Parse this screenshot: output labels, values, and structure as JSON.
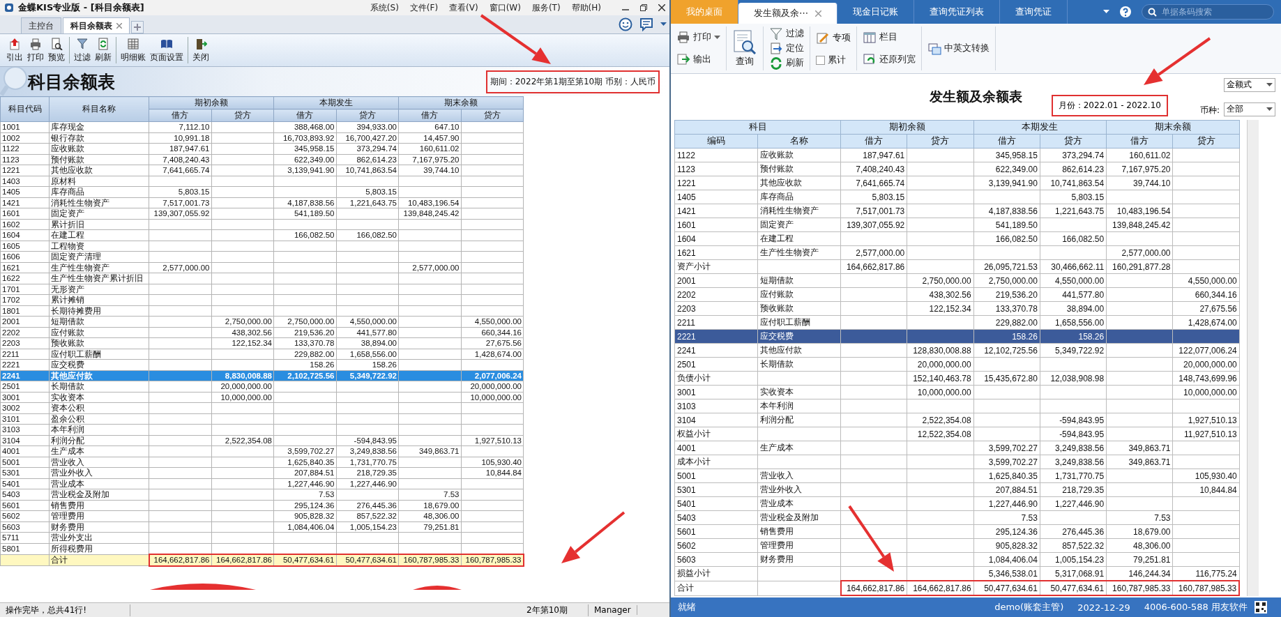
{
  "left_window": {
    "app_title": "金蝶KIS专业版 - [科目余额表]",
    "menu": [
      "系统(S)",
      "文件(F)",
      "查看(V)",
      "窗口(W)",
      "服务(T)",
      "帮助(H)"
    ],
    "tabs": [
      {
        "label": "主控台",
        "selected": false
      },
      {
        "label": "科目余额表",
        "selected": true
      }
    ],
    "toolbar": [
      "引出",
      "打印",
      "预览",
      "过滤",
      "刷新",
      "明细账",
      "页面设置",
      "关闭"
    ],
    "report_title": "科目余额表",
    "period_info": "期间：2022年第1期至第10期 币别：人民币",
    "header": {
      "code": "科目代码",
      "name": "科目名称",
      "groups": [
        "期初余额",
        "本期发生",
        "期末余额"
      ],
      "sides": [
        "借方",
        "贷方",
        "借方",
        "贷方",
        "借方",
        "贷方"
      ]
    },
    "rows": [
      {
        "code": "1001",
        "name": "库存现金",
        "selected": false,
        "values": {
          "opening_debit": "7,112.10",
          "period_debit": "388,468.00",
          "period_credit": "394,933.00",
          "closing_debit": "647.10"
        }
      },
      {
        "code": "1002",
        "name": "银行存款",
        "selected": false,
        "values": {
          "opening_debit": "10,991.18",
          "period_debit": "16,703,893.92",
          "period_credit": "16,700,427.20",
          "closing_debit": "14,457.90"
        }
      },
      {
        "code": "1122",
        "name": "应收账款",
        "selected": false,
        "values": {
          "opening_debit": "187,947.61",
          "period_debit": "345,958.15",
          "period_credit": "373,294.74",
          "closing_debit": "160,611.02"
        }
      },
      {
        "code": "1123",
        "name": "预付账款",
        "selected": false,
        "values": {
          "opening_debit": "7,408,240.43",
          "period_debit": "622,349.00",
          "period_credit": "862,614.23",
          "closing_debit": "7,167,975.20"
        }
      },
      {
        "code": "1221",
        "name": "其他应收款",
        "selected": false,
        "values": {
          "opening_debit": "7,641,665.74",
          "period_debit": "3,139,941.90",
          "period_credit": "10,741,863.54",
          "closing_debit": "39,744.10"
        }
      },
      {
        "code": "1403",
        "name": "原材料",
        "selected": false
      },
      {
        "code": "1405",
        "name": "库存商品",
        "selected": false,
        "values": {
          "opening_debit": "5,803.15",
          "period_credit": "5,803.15"
        }
      },
      {
        "code": "1421",
        "name": "消耗性生物资产",
        "selected": false,
        "values": {
          "opening_debit": "7,517,001.73",
          "period_debit": "4,187,838.56",
          "period_credit": "1,221,643.75",
          "closing_debit": "10,483,196.54"
        }
      },
      {
        "code": "1601",
        "name": "固定资产",
        "selected": false,
        "values": {
          "opening_debit": "139,307,055.92",
          "period_debit": "541,189.50",
          "closing_debit": "139,848,245.42"
        }
      },
      {
        "code": "1602",
        "name": "累计折旧",
        "selected": false
      },
      {
        "code": "1604",
        "name": "在建工程",
        "selected": false,
        "values": {
          "period_debit": "166,082.50",
          "period_credit": "166,082.50"
        }
      },
      {
        "code": "1605",
        "name": "工程物资",
        "selected": false
      },
      {
        "code": "1606",
        "name": "固定资产清理",
        "selected": false
      },
      {
        "code": "1621",
        "name": "生产性生物资产",
        "selected": false,
        "values": {
          "opening_debit": "2,577,000.00",
          "closing_debit": "2,577,000.00"
        }
      },
      {
        "code": "1622",
        "name": "生产性生物资产累计折旧",
        "selected": false
      },
      {
        "code": "1701",
        "name": "无形资产",
        "selected": false
      },
      {
        "code": "1702",
        "name": "累计摊销",
        "selected": false
      },
      {
        "code": "1801",
        "name": "长期待摊费用",
        "selected": false
      },
      {
        "code": "2001",
        "name": "短期借款",
        "selected": false,
        "values": {
          "opening_credit": "2,750,000.00",
          "period_debit": "2,750,000.00",
          "period_credit": "4,550,000.00",
          "closing_credit": "4,550,000.00"
        }
      },
      {
        "code": "2202",
        "name": "应付账款",
        "selected": false,
        "values": {
          "opening_credit": "438,302.56",
          "period_debit": "219,536.20",
          "period_credit": "441,577.80",
          "closing_credit": "660,344.16"
        }
      },
      {
        "code": "2203",
        "name": "预收账款",
        "selected": false,
        "values": {
          "opening_credit": "122,152.34",
          "period_debit": "133,370.78",
          "period_credit": "38,894.00",
          "closing_credit": "27,675.56"
        }
      },
      {
        "code": "2211",
        "name": "应付职工薪酬",
        "selected": false,
        "values": {
          "period_debit": "229,882.00",
          "period_credit": "1,658,556.00",
          "closing_credit": "1,428,674.00"
        }
      },
      {
        "code": "2221",
        "name": "应交税费",
        "selected": false,
        "values": {
          "period_debit": "158.26",
          "period_credit": "158.26"
        }
      },
      {
        "code": "2241",
        "name": "其他应付款",
        "selected": true,
        "values": {
          "opening_credit": "8,830,008.88",
          "period_debit": "2,102,725.56",
          "period_credit": "5,349,722.92",
          "closing_credit": "2,077,006.24"
        }
      },
      {
        "code": "2501",
        "name": "长期借款",
        "selected": false,
        "values": {
          "opening_credit": "20,000,000.00",
          "closing_credit": "20,000,000.00"
        }
      },
      {
        "code": "3001",
        "name": "实收资本",
        "selected": false,
        "values": {
          "opening_credit": "10,000,000.00",
          "closing_credit": "10,000,000.00"
        }
      },
      {
        "code": "3002",
        "name": "资本公积",
        "selected": false
      },
      {
        "code": "3101",
        "name": "盈余公积",
        "selected": false
      },
      {
        "code": "3103",
        "name": "本年利润",
        "selected": false
      },
      {
        "code": "3104",
        "name": "利润分配",
        "selected": false,
        "values": {
          "opening_credit": "2,522,354.08",
          "period_credit": "-594,843.95",
          "closing_credit": "1,927,510.13"
        }
      },
      {
        "code": "4001",
        "name": "生产成本",
        "selected": false,
        "values": {
          "period_debit": "3,599,702.27",
          "period_credit": "3,249,838.56",
          "closing_debit": "349,863.71"
        }
      },
      {
        "code": "5001",
        "name": "营业收入",
        "selected": false,
        "values": {
          "period_debit": "1,625,840.35",
          "period_credit": "1,731,770.75",
          "closing_credit": "105,930.40"
        }
      },
      {
        "code": "5301",
        "name": "营业外收入",
        "selected": false,
        "values": {
          "period_debit": "207,884.51",
          "period_credit": "218,729.35",
          "closing_credit": "10,844.84"
        }
      },
      {
        "code": "5401",
        "name": "营业成本",
        "selected": false,
        "values": {
          "period_debit": "1,227,446.90",
          "period_credit": "1,227,446.90"
        }
      },
      {
        "code": "5403",
        "name": "营业税金及附加",
        "selected": false,
        "values": {
          "period_debit": "7.53",
          "closing_debit": "7.53"
        }
      },
      {
        "code": "5601",
        "name": "销售费用",
        "selected": false,
        "values": {
          "period_debit": "295,124.36",
          "period_credit": "276,445.36",
          "closing_debit": "18,679.00"
        }
      },
      {
        "code": "5602",
        "name": "管理费用",
        "selected": false,
        "values": {
          "period_debit": "905,828.32",
          "period_credit": "857,522.32",
          "closing_debit": "48,306.00"
        }
      },
      {
        "code": "5603",
        "name": "财务费用",
        "selected": false,
        "values": {
          "period_debit": "1,084,406.04",
          "period_credit": "1,005,154.23",
          "closing_debit": "79,251.81"
        }
      },
      {
        "code": "5711",
        "name": "营业外支出",
        "selected": false
      },
      {
        "code": "5801",
        "name": "所得税费用",
        "selected": false
      }
    ],
    "total": {
      "label": "合计",
      "values": {
        "opening_debit": "164,662,817.86",
        "opening_credit": "164,662,817.86",
        "period_debit": "50,477,634.61",
        "period_credit": "50,477,634.61",
        "closing_debit": "160,787,985.33",
        "closing_credit": "160,787,985.33"
      }
    },
    "status": [
      "操作完毕，总共41行!",
      "2年第10期",
      "Manager"
    ]
  },
  "right_window": {
    "tabs": [
      {
        "label": "我的桌面",
        "kind": "home",
        "selected": false
      },
      {
        "label": "发生额及余⋯",
        "kind": "page",
        "selected": true
      },
      {
        "label": "现金日记账",
        "kind": "page",
        "selected": false
      },
      {
        "label": "查询凭证列表",
        "kind": "page",
        "selected": false
      },
      {
        "label": "查询凭证",
        "kind": "page",
        "selected": false
      }
    ],
    "search": {
      "placeholder": "单据条码搜索"
    },
    "toolbar_groups": [
      {
        "items": [
          {
            "label": "打印",
            "kind": "dropdown"
          },
          {
            "label": "输出",
            "kind": "button"
          }
        ]
      },
      {
        "items": [
          {
            "label": "查询",
            "kind": "large"
          }
        ]
      },
      {
        "items": [
          {
            "label": "过滤",
            "kind": "button"
          },
          {
            "label": "定位",
            "kind": "button"
          },
          {
            "label": "刷新",
            "kind": "button"
          }
        ]
      },
      {
        "items": [
          {
            "label": "专项",
            "kind": "button"
          },
          {
            "label": "累计",
            "kind": "checkbox",
            "checked": false
          }
        ]
      },
      {
        "items": [
          {
            "label": "栏目",
            "kind": "button"
          },
          {
            "label": "还原列宽",
            "kind": "button"
          }
        ]
      },
      {
        "items": [
          {
            "label": "中英文转换",
            "kind": "button"
          }
        ]
      }
    ],
    "report_title": "发生额及余额表",
    "period": "月份：2022.01 - 2022.10",
    "format_select": "金额式",
    "currency_label": "币种:",
    "currency_select": "全部",
    "header": {
      "subject": "科目",
      "code": "编码",
      "name": "名称",
      "groups": [
        "期初余额",
        "本期发生",
        "期末余额"
      ],
      "sides": [
        "借方",
        "贷方",
        "借方",
        "贷方",
        "借方",
        "贷方"
      ]
    },
    "rows": [
      {
        "kind": "account",
        "code": "1122",
        "name": "应收账款",
        "selected": false,
        "values": {
          "opening_debit": "187,947.61",
          "period_debit": "345,958.15",
          "period_credit": "373,294.74",
          "closing_debit": "160,611.02"
        }
      },
      {
        "kind": "account",
        "code": "1123",
        "name": "预付账款",
        "selected": false,
        "values": {
          "opening_debit": "7,408,240.43",
          "period_debit": "622,349.00",
          "period_credit": "862,614.23",
          "closing_debit": "7,167,975.20"
        }
      },
      {
        "kind": "account",
        "code": "1221",
        "name": "其他应收款",
        "selected": false,
        "values": {
          "opening_debit": "7,641,665.74",
          "period_debit": "3,139,941.90",
          "period_credit": "10,741,863.54",
          "closing_debit": "39,744.10"
        }
      },
      {
        "kind": "account",
        "code": "1405",
        "name": "库存商品",
        "selected": false,
        "values": {
          "opening_debit": "5,803.15",
          "period_credit": "5,803.15"
        }
      },
      {
        "kind": "account",
        "code": "1421",
        "name": "消耗性生物资产",
        "selected": false,
        "values": {
          "opening_debit": "7,517,001.73",
          "period_debit": "4,187,838.56",
          "period_credit": "1,221,643.75",
          "closing_debit": "10,483,196.54"
        }
      },
      {
        "kind": "account",
        "code": "1601",
        "name": "固定资产",
        "selected": false,
        "values": {
          "opening_debit": "139,307,055.92",
          "period_debit": "541,189.50",
          "closing_debit": "139,848,245.42"
        }
      },
      {
        "kind": "account",
        "code": "1604",
        "name": "在建工程",
        "selected": false,
        "values": {
          "period_debit": "166,082.50",
          "period_credit": "166,082.50"
        }
      },
      {
        "kind": "account",
        "code": "1621",
        "name": "生产性生物资产",
        "selected": false,
        "values": {
          "opening_debit": "2,577,000.00",
          "closing_debit": "2,577,000.00"
        }
      },
      {
        "kind": "subtotal",
        "code": "资产小计",
        "selected": false,
        "values": {
          "opening_debit": "164,662,817.86",
          "period_debit": "26,095,721.53",
          "period_credit": "30,466,662.11",
          "closing_debit": "160,291,877.28"
        }
      },
      {
        "kind": "account",
        "code": "2001",
        "name": "短期借款",
        "selected": false,
        "values": {
          "opening_credit": "2,750,000.00",
          "period_debit": "2,750,000.00",
          "period_credit": "4,550,000.00",
          "closing_credit": "4,550,000.00"
        }
      },
      {
        "kind": "account",
        "code": "2202",
        "name": "应付账款",
        "selected": false,
        "values": {
          "opening_credit": "438,302.56",
          "period_debit": "219,536.20",
          "period_credit": "441,577.80",
          "closing_credit": "660,344.16"
        }
      },
      {
        "kind": "account",
        "code": "2203",
        "name": "预收账款",
        "selected": false,
        "values": {
          "opening_credit": "122,152.34",
          "period_debit": "133,370.78",
          "period_credit": "38,894.00",
          "closing_credit": "27,675.56"
        }
      },
      {
        "kind": "account",
        "code": "2211",
        "name": "应付职工薪酬",
        "selected": false,
        "values": {
          "period_debit": "229,882.00",
          "period_credit": "1,658,556.00",
          "closing_credit": "1,428,674.00"
        }
      },
      {
        "kind": "account",
        "code": "2221",
        "name": "应交税费",
        "selected": true,
        "values": {
          "period_debit": "158.26",
          "period_credit": "158.26"
        }
      },
      {
        "kind": "account",
        "code": "2241",
        "name": "其他应付款",
        "selected": false,
        "values": {
          "opening_credit": "128,830,008.88",
          "period_debit": "12,102,725.56",
          "period_credit": "5,349,722.92",
          "closing_credit": "122,077,006.24"
        }
      },
      {
        "kind": "account",
        "code": "2501",
        "name": "长期借款",
        "selected": false,
        "values": {
          "opening_credit": "20,000,000.00",
          "closing_credit": "20,000,000.00"
        }
      },
      {
        "kind": "subtotal",
        "code": "负债小计",
        "selected": false,
        "values": {
          "opening_credit": "152,140,463.78",
          "period_debit": "15,435,672.80",
          "period_credit": "12,038,908.98",
          "closing_credit": "148,743,699.96"
        }
      },
      {
        "kind": "account",
        "code": "3001",
        "name": "实收资本",
        "selected": false,
        "values": {
          "opening_credit": "10,000,000.00",
          "closing_credit": "10,000,000.00"
        }
      },
      {
        "kind": "account",
        "code": "3103",
        "name": "本年利润",
        "selected": false
      },
      {
        "kind": "account",
        "code": "3104",
        "name": "利润分配",
        "selected": false,
        "values": {
          "opening_credit": "2,522,354.08",
          "period_credit": "-594,843.95",
          "closing_credit": "1,927,510.13"
        }
      },
      {
        "kind": "subtotal",
        "code": "权益小计",
        "selected": false,
        "values": {
          "opening_credit": "12,522,354.08",
          "period_credit": "-594,843.95",
          "closing_credit": "11,927,510.13"
        }
      },
      {
        "kind": "account",
        "code": "4001",
        "name": "生产成本",
        "selected": false,
        "values": {
          "period_debit": "3,599,702.27",
          "period_credit": "3,249,838.56",
          "closing_debit": "349,863.71"
        }
      },
      {
        "kind": "subtotal",
        "code": "成本小计",
        "selected": false,
        "values": {
          "period_debit": "3,599,702.27",
          "period_credit": "3,249,838.56",
          "closing_debit": "349,863.71"
        }
      },
      {
        "kind": "account",
        "code": "5001",
        "name": "营业收入",
        "selected": false,
        "values": {
          "period_debit": "1,625,840.35",
          "period_credit": "1,731,770.75",
          "closing_credit": "105,930.40"
        }
      },
      {
        "kind": "account",
        "code": "5301",
        "name": "营业外收入",
        "selected": false,
        "values": {
          "period_debit": "207,884.51",
          "period_credit": "218,729.35",
          "closing_credit": "10,844.84"
        }
      },
      {
        "kind": "account",
        "code": "5401",
        "name": "营业成本",
        "selected": false,
        "values": {
          "period_debit": "1,227,446.90",
          "period_credit": "1,227,446.90"
        }
      },
      {
        "kind": "account",
        "code": "5403",
        "name": "营业税金及附加",
        "selected": false,
        "values": {
          "period_debit": "7.53",
          "closing_debit": "7.53"
        }
      },
      {
        "kind": "account",
        "code": "5601",
        "name": "销售费用",
        "selected": false,
        "values": {
          "period_debit": "295,124.36",
          "period_credit": "276,445.36",
          "closing_debit": "18,679.00"
        }
      },
      {
        "kind": "account",
        "code": "5602",
        "name": "管理费用",
        "selected": false,
        "values": {
          "period_debit": "905,828.32",
          "period_credit": "857,522.32",
          "closing_debit": "48,306.00"
        }
      },
      {
        "kind": "account",
        "code": "5603",
        "name": "财务费用",
        "selected": false,
        "values": {
          "period_debit": "1,084,406.04",
          "period_credit": "1,005,154.23",
          "closing_debit": "79,251.81"
        }
      },
      {
        "kind": "subtotal",
        "code": "损益小计",
        "selected": false,
        "values": {
          "period_debit": "5,346,538.01",
          "period_credit": "5,317,068.91",
          "closing_debit": "146,244.34",
          "closing_credit": "116,775.24"
        }
      },
      {
        "kind": "total",
        "code": "合计",
        "selected": false,
        "values": {
          "opening_debit": "164,662,817.86",
          "opening_credit": "164,662,817.86",
          "period_debit": "50,477,634.61",
          "period_credit": "50,477,634.61",
          "closing_debit": "160,787,985.33",
          "closing_credit": "160,787,985.33"
        }
      }
    ],
    "status": [
      "就绪",
      "demo(账套主管)",
      "2022-12-29",
      "4006-600-588 用友软件"
    ]
  }
}
